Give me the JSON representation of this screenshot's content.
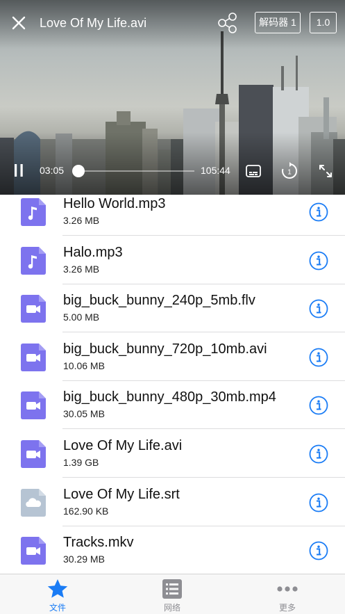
{
  "player": {
    "title": "Love Of My Life.avi",
    "decoder_label": "解码器 1",
    "speed_label": "1.0",
    "current_time": "03:05",
    "total_time": "105:44",
    "progress": 0.03
  },
  "files": [
    {
      "name": "Hello World.mp3",
      "size": "3.26 MB",
      "type": "audio"
    },
    {
      "name": "Halo.mp3",
      "size": "3.26 MB",
      "type": "audio"
    },
    {
      "name": "big_buck_bunny_240p_5mb.flv",
      "size": "5.00 MB",
      "type": "video"
    },
    {
      "name": "big_buck_bunny_720p_10mb.avi",
      "size": "10.06 MB",
      "type": "video"
    },
    {
      "name": "big_buck_bunny_480p_30mb.mp4",
      "size": "30.05 MB",
      "type": "video"
    },
    {
      "name": "Love Of My Life.avi",
      "size": "1.39 GB",
      "type": "video"
    },
    {
      "name": "Love Of My Life.srt",
      "size": "162.90 KB",
      "type": "cloud"
    },
    {
      "name": "Tracks.mkv",
      "size": "30.29 MB",
      "type": "video"
    }
  ],
  "tabs": [
    {
      "label": "文件",
      "icon": "star-icon",
      "active": true
    },
    {
      "label": "网络",
      "icon": "list-icon",
      "active": false
    },
    {
      "label": "更多",
      "icon": "more-icon",
      "active": false
    }
  ],
  "colors": {
    "accent": "#1a7cf5",
    "file_icon_purple": "#7d73ee",
    "file_icon_gray": "#b6c4d3",
    "tab_inactive": "#8e8e93"
  }
}
